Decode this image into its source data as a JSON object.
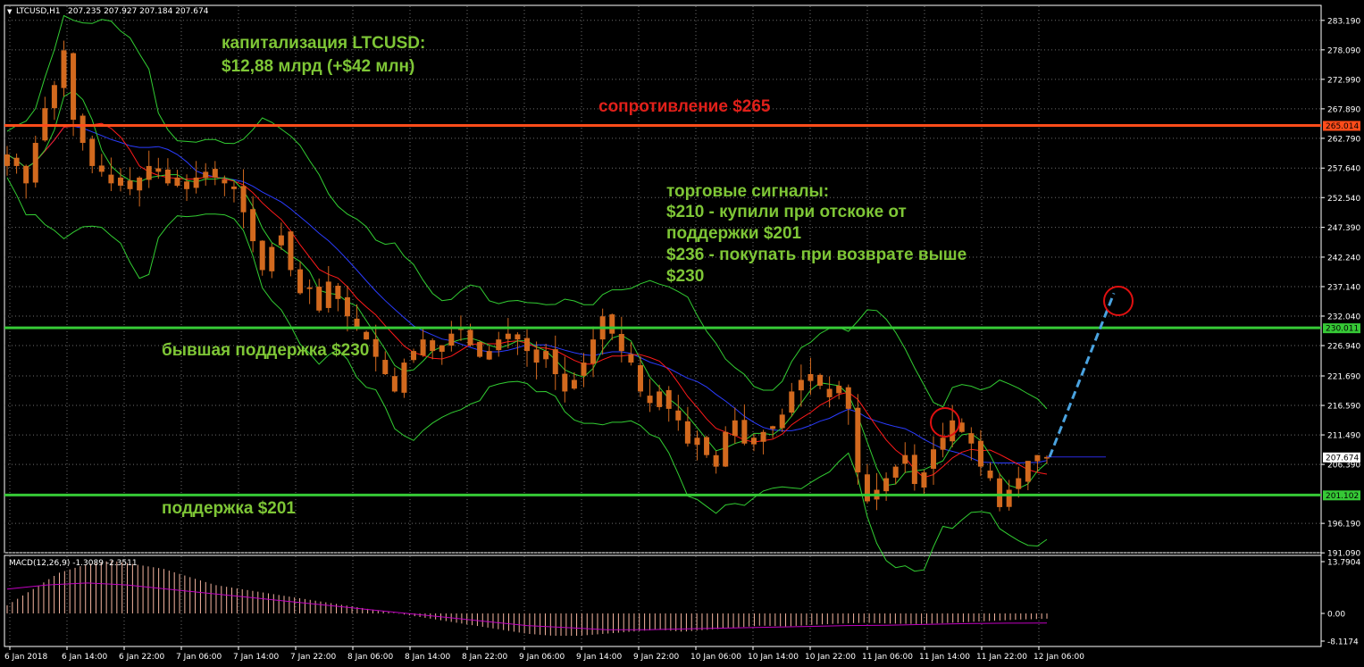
{
  "header": {
    "symbol": "LTCUSD,H1",
    "ohlc": "207.235 207.927 207.184 207.674",
    "macd_label": "MACD(12,26,9) -1.3089 -2.3511"
  },
  "annotations": {
    "cap_line1": "капитализация LTCUSD:",
    "cap_line2": "$12,88 млрд (+$42 млн)",
    "resistance": "сопротивление $265",
    "signals_title": "торговые сигналы:",
    "signals_l1": "$210 - купили при отскоке от",
    "signals_l2": "поддержки $201",
    "signals_l3": "$236 - покупать при возврате выше",
    "signals_l4": "$230",
    "former_support": "бывшая поддержка $230",
    "support": "поддержка $201"
  },
  "colors": {
    "background": "#000000",
    "grid": "#6e6e6e",
    "candle": "#d2691e",
    "resistance_line": "#ff4c1a",
    "support_line": "#36c936",
    "annotation_text": "#7ec636",
    "resistance_text": "#e0201a",
    "ma_red": "#ff1a1a",
    "ma_blue": "#2a3cff",
    "ma_green": "#32cd32",
    "macd_hist": "#f5b5a0",
    "macd_signal": "#c000c0",
    "arrow": "#4aa3e0",
    "circle": "#e01010",
    "current_price_line": "#2a2ae0"
  },
  "chart_data": {
    "type": "candlestick",
    "title": "LTCUSD,H1",
    "price_axis_ticks": [
      "283.190",
      "278.090",
      "272.990",
      "267.890",
      "262.790",
      "257.640",
      "252.540",
      "247.390",
      "242.240",
      "237.140",
      "232.040",
      "226.940",
      "221.690",
      "216.590",
      "211.490",
      "206.390",
      "196.190",
      "191.090"
    ],
    "y_range": [
      189.0,
      286.0
    ],
    "macd_axis_ticks": [
      "13.7904",
      "0.00",
      "-8.1174"
    ],
    "x_tick_labels": [
      "6 Jan 2018",
      "6 Jan 14:00",
      "6 Jan 22:00",
      "7 Jan 06:00",
      "7 Jan 14:00",
      "7 Jan 22:00",
      "8 Jan 06:00",
      "8 Jan 14:00",
      "8 Jan 22:00",
      "9 Jan 06:00",
      "9 Jan 14:00",
      "9 Jan 22:00",
      "10 Jan 06:00",
      "10 Jan 14:00",
      "10 Jan 22:00",
      "11 Jan 06:00",
      "11 Jan 14:00",
      "11 Jan 22:00",
      "12 Jan 06:00"
    ],
    "levels": [
      {
        "name": "resistance",
        "value": 265.014,
        "label": "265.014"
      },
      {
        "name": "former-support",
        "value": 230.011,
        "label": "230.011"
      },
      {
        "name": "support",
        "value": 201.102,
        "label": "201.102"
      }
    ],
    "current_price": {
      "value": 207.674,
      "label": "207.674"
    },
    "candle_close_keypoints": [
      260,
      258,
      255,
      262,
      268,
      272,
      278,
      266,
      262,
      258,
      257,
      255,
      256,
      254,
      256,
      258,
      257,
      255,
      256,
      254,
      256,
      257,
      256,
      255,
      254,
      250,
      245,
      240,
      244,
      246,
      240,
      236,
      237,
      233,
      238,
      235,
      232,
      230,
      228,
      225,
      222,
      219,
      224,
      226,
      228,
      226,
      227,
      229,
      230,
      227,
      225,
      226,
      228,
      229,
      228,
      226,
      224,
      226,
      222,
      219,
      221,
      224,
      228,
      232,
      229,
      226,
      224,
      219,
      217,
      219,
      216,
      214,
      210,
      211,
      208,
      206,
      212,
      214,
      210,
      211,
      212,
      213,
      215,
      219,
      221,
      222,
      220,
      218,
      220,
      216,
      205,
      200,
      202,
      204,
      206,
      208,
      203,
      205,
      209,
      211,
      214,
      212,
      210,
      206,
      204,
      199,
      202,
      204,
      207,
      208,
      207.674
    ],
    "macd_hist_keypoints": [
      2,
      6,
      10,
      12,
      13,
      12,
      11,
      9,
      7,
      6,
      5,
      4,
      3,
      2,
      1,
      0,
      -1,
      -2,
      -3,
      -4,
      -5,
      -5.5,
      -5.5,
      -5,
      -4.5,
      -4,
      -4.5,
      -4,
      -3.5,
      -3,
      -3.2,
      -2.8,
      -2.5,
      -2.3,
      -2.5,
      -2.6,
      -2.4,
      -2.1,
      -1.8,
      -1.5,
      -1.3
    ],
    "macd_signal_keypoints": [
      6,
      7,
      7.5,
      7,
      6,
      5,
      4,
      3,
      2,
      1,
      0,
      -1,
      -2,
      -3,
      -3.5,
      -4,
      -4,
      -3.8,
      -3.6,
      -3.4,
      -3.2,
      -3,
      -2.9,
      -2.7,
      -2.5,
      -2.4,
      -2.35
    ],
    "projection": {
      "from": 207.674,
      "to": 236
    }
  }
}
